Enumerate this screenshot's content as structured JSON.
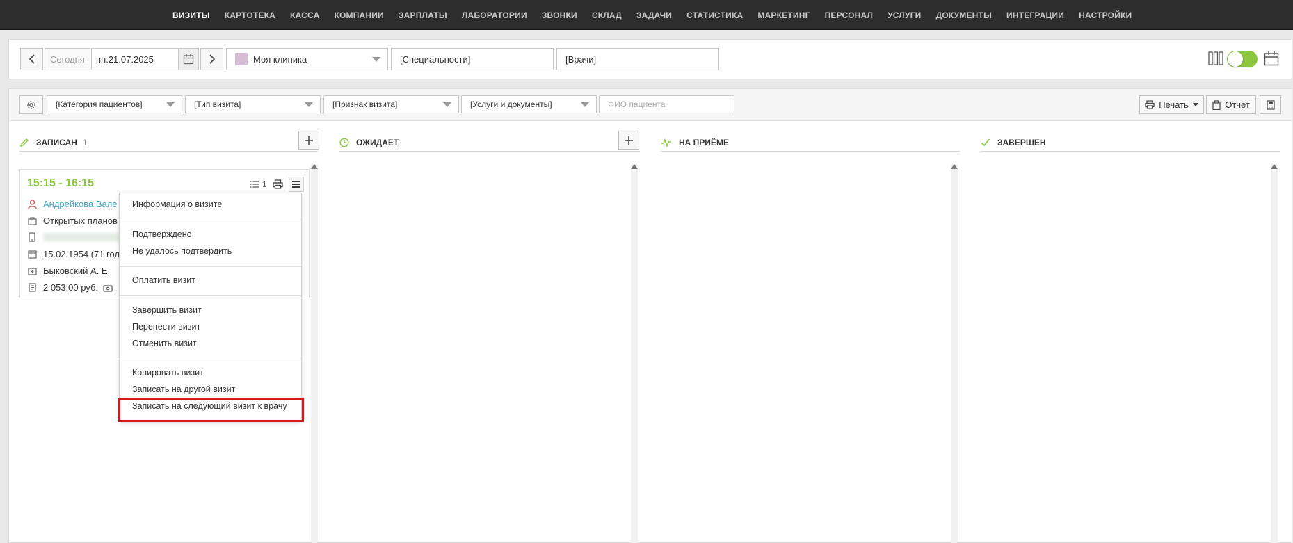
{
  "nav": {
    "items": [
      "ВИЗИТЫ",
      "КАРТОТЕКА",
      "КАССА",
      "КОМПАНИИ",
      "ЗАРПЛАТЫ",
      "ЛАБОРАТОРИИ",
      "ЗВОНКИ",
      "СКЛАД",
      "ЗАДАЧИ",
      "СТАТИСТИКА",
      "МАРКЕТИНГ",
      "ПЕРСОНАЛ",
      "УСЛУГИ",
      "ДОКУМЕНТЫ",
      "ИНТЕГРАЦИИ",
      "НАСТРОЙКИ"
    ],
    "active": "ВИЗИТЫ"
  },
  "datebar": {
    "today_label": "Сегодня",
    "date_value": "пн.21.07.2025",
    "clinic": "Моя клиника",
    "clinic_color": "#d6bdd6",
    "specialties": "[Специальности]",
    "doctors": "[Врачи]"
  },
  "filters": {
    "patient_category": "[Категория пациентов]",
    "visit_type": "[Тип визита]",
    "visit_sign": "[Признак визита]",
    "services_docs": "[Услуги и документы]",
    "patient_name_placeholder": "ФИО пациента",
    "print_label": "Печать",
    "report_label": "Отчет"
  },
  "columns": [
    {
      "title": "ЗАПИСАН",
      "count": "1",
      "icon": "pencil-icon"
    },
    {
      "title": "ОЖИДАЕТ",
      "count": "",
      "icon": "clock-icon"
    },
    {
      "title": "НА ПРИЁМЕ",
      "count": "",
      "icon": "pulse-icon"
    },
    {
      "title": "ЗАВЕРШЕН",
      "count": "",
      "icon": "check-icon"
    }
  ],
  "card": {
    "time": "15:15 - 16:15",
    "patient": "Андрейкова Вале",
    "visit_type": "Открытых планов",
    "birthdate": "15.02.1954 (71 год)",
    "doctor": "Быковский А. Е.",
    "amount": "2 053,00 руб.",
    "services_count": "1"
  },
  "context_menu": {
    "items": [
      "Информация о визите",
      "Подтверждено",
      "Не удалось подтвердить",
      "Оплатить визит",
      "Завершить визит",
      "Перенести визит",
      "Отменить визит",
      "Копировать визит",
      "Записать на другой визит",
      "Записать на следующий визит к врачу"
    ],
    "highlight_color": "#d9161c"
  },
  "colors": {
    "accent_green": "#8cc63f",
    "link_blue": "#3aa6c4",
    "nav_bg": "#2d2d2d"
  }
}
